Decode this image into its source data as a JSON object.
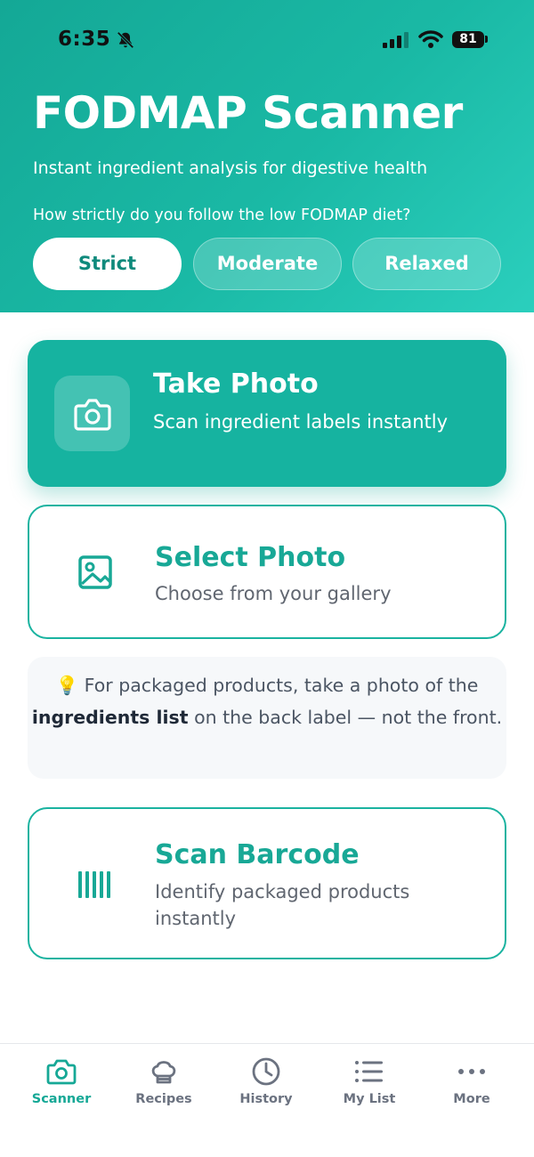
{
  "status": {
    "time": "6:35",
    "battery": "81"
  },
  "header": {
    "title": "FODMAP Scanner",
    "subtitle": "Instant ingredient analysis for digestive health",
    "question": "How strictly do you follow the low FODMAP diet?",
    "levels": [
      {
        "label": "Strict",
        "selected": true
      },
      {
        "label": "Moderate",
        "selected": false
      },
      {
        "label": "Relaxed",
        "selected": false
      }
    ]
  },
  "actions": {
    "take_photo": {
      "title": "Take Photo",
      "desc": "Scan ingredient labels instantly",
      "icon": "camera-icon"
    },
    "select_photo": {
      "title": "Select Photo",
      "desc": "Choose from your gallery",
      "icon": "image-icon"
    },
    "scan_barcode": {
      "title": "Scan Barcode",
      "desc": "Identify packaged products instantly",
      "icon": "barcode-icon"
    }
  },
  "tip": {
    "icon": "lightbulb-icon",
    "before": "For packaged products, take a photo of the",
    "bold": "ingredients list",
    "after": "on the back label — not the front."
  },
  "tabs": [
    {
      "label": "Scanner",
      "icon": "camera-icon",
      "active": true
    },
    {
      "label": "Recipes",
      "icon": "chef-hat-icon",
      "active": false
    },
    {
      "label": "History",
      "icon": "clock-icon",
      "active": false
    },
    {
      "label": "My List",
      "icon": "list-icon",
      "active": false
    },
    {
      "label": "More",
      "icon": "more-dots-icon",
      "active": false
    }
  ],
  "colors": {
    "accent": "#16b3a0",
    "accent_dark": "#0f8a7c",
    "muted": "#6b7280"
  }
}
